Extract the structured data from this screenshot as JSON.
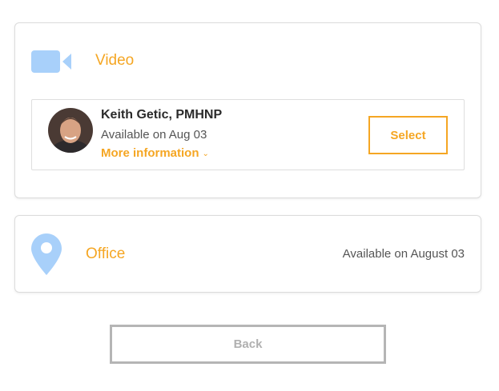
{
  "colors": {
    "accent": "#f5a623",
    "icon": "#a8d0fa",
    "muted": "#b0b0b0"
  },
  "video": {
    "icon": "video-camera-icon",
    "title": "Video",
    "provider": {
      "name": "Keith Getic, PMHNP",
      "availability": "Available on Aug 03",
      "more_info_label": "More information",
      "more_info_icon": "chevron-down-icon",
      "select_label": "Select"
    }
  },
  "office": {
    "icon": "map-pin-icon",
    "title": "Office",
    "availability": "Available on August 03"
  },
  "back_label": "Back"
}
